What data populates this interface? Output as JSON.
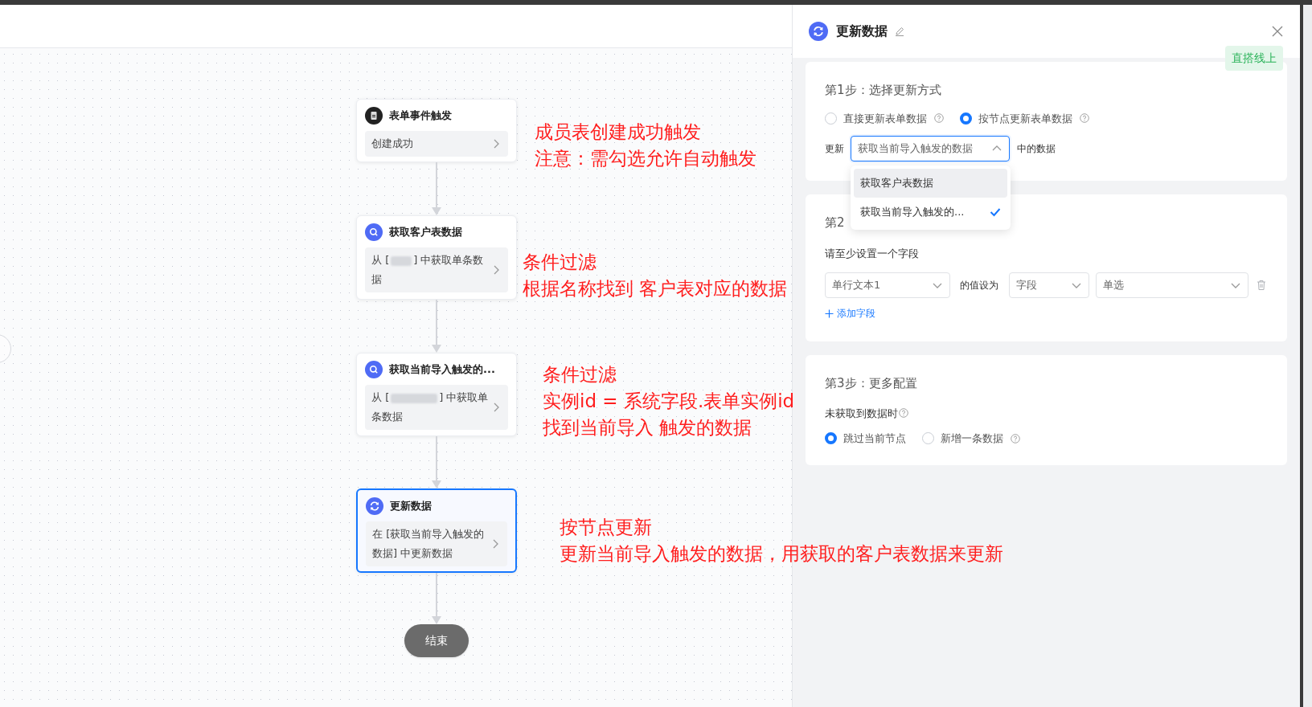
{
  "flow": {
    "nodes": [
      {
        "kind": "trigger",
        "title": "表单事件触发",
        "body": "创建成功",
        "selected": false
      },
      {
        "kind": "query",
        "title": "获取客户表数据",
        "body_before": "从 [",
        "body_after": "] 中获取单条数据",
        "selected": false
      },
      {
        "kind": "query",
        "title": "获取当前导入触发的...",
        "body_before": "从 [",
        "body_after": "] 中获取单条数据",
        "selected": false
      },
      {
        "kind": "update",
        "title": "更新数据",
        "body": "在 [获取当前导入触发的数据] 中更新数据",
        "selected": true
      }
    ],
    "end": "结束"
  },
  "annotations": [
    {
      "lines": [
        "成员表创建成功触发",
        "注意：需勾选允许自动触发"
      ]
    },
    {
      "lines": [
        "条件过滤",
        "根据名称找到 客户表对应的数据"
      ]
    },
    {
      "lines": [
        "条件过滤",
        "实例id = 系统字段.表单实例id",
        "找到当前导入 触发的数据"
      ]
    },
    {
      "lines": [
        "按节点更新",
        "更新当前导入触发的数据，用获取的客户表数据来更新"
      ]
    }
  ],
  "panel": {
    "title": "更新数据",
    "badge": "直搭线上",
    "step1": {
      "title": "第1步：选择更新方式",
      "modes": [
        {
          "label": "直接更新表单数据",
          "help": true,
          "selected": false
        },
        {
          "label": "按节点更新表单数据",
          "help": true,
          "selected": true
        }
      ],
      "update_label": "更新",
      "source": {
        "value": "获取当前导入触发的数据",
        "expanded": true
      },
      "suffix": "中的数据",
      "options": [
        {
          "label": "获取客户表数据",
          "highlighted": true,
          "selected": false
        },
        {
          "label": "获取当前导入触发的...",
          "highlighted": false,
          "selected": true
        }
      ]
    },
    "step2": {
      "title": "第2",
      "hint": "请至少设置一个字段",
      "field": "单行文本1",
      "set_label": "的值设为",
      "value_type": "字段",
      "value": "单选",
      "add_link": "添加字段"
    },
    "step3": {
      "title": "第3步：更多配置",
      "label": "未获取到数据时",
      "options": [
        {
          "label": "跳过当前节点",
          "help": false,
          "selected": true
        },
        {
          "label": "新增一条数据",
          "help": true,
          "selected": false
        }
      ]
    }
  }
}
